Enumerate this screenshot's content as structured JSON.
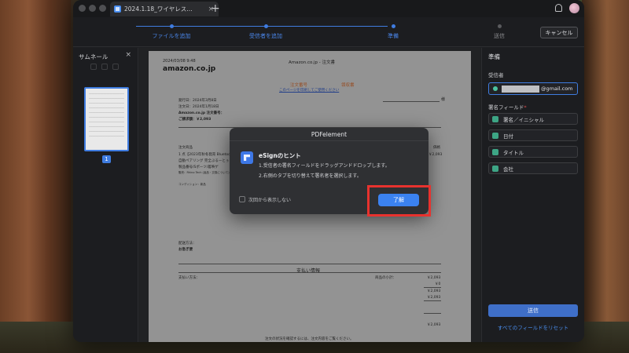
{
  "titlebar": {
    "tab_title": "2024.1.18_ワイヤレス…",
    "tab_close": "×",
    "new_tab": "+"
  },
  "steps": [
    {
      "label": "ファイルを追加",
      "state": "done"
    },
    {
      "label": "受信者を追加",
      "state": "done"
    },
    {
      "label": "準備",
      "state": "current"
    },
    {
      "label": "送信",
      "state": "pending"
    }
  ],
  "toolbar": {
    "cancel_label": "キャンセル"
  },
  "sidebar": {
    "title": "サムネール",
    "close": "×",
    "page_number": "1"
  },
  "document": {
    "header_date": "2024/03/08 9:48",
    "header_title": "Amazon.co.jp - 注文書",
    "logo": "amazon.co.jp",
    "order_label": "注文番号",
    "receipt_label": "領収書",
    "print_link": "このページを印刷してご使用ください",
    "line1": "発行日：2024年3月8日",
    "line2": "注文日：2024年1月18日",
    "line3": "Amazon.co.jp 注文番号：",
    "line4": "ご請求額：￥2,093",
    "honorific": "様",
    "item_head": "注文商品",
    "item1": "1 点【2023年秋冬発売 Bluetoo",
    "item2": "自動ペアリング 完全ぶるーとぅ",
    "item3": "製品番号/Sポーツ/着映ゲ",
    "item4": "販売：Rhino Tech (返品・交換について)",
    "condition": "コンディション：新品",
    "price_head": "価格",
    "price_val": "￥2,093",
    "ship_label": "配送方法：",
    "ship_val": "お急ぎ便",
    "payment_title": "支払い情報",
    "payment_method": "支払い方法：",
    "subtotal_label": "商品の小計：",
    "sub1": "￥2,093",
    "sub2": "￥0",
    "sub3": "￥2,093",
    "sub4": "￥2,093",
    "sub5": "￥2,093",
    "footer": "注文の状況を確認するには、注文内容をご覧ください。"
  },
  "right_panel": {
    "title": "準備",
    "recipient_label": "受信者",
    "recipient_email_suffix": "@gmail.com",
    "fields_label": "署名フィールド",
    "required_mark": "*",
    "fields": [
      {
        "label": "署名／イニシャル",
        "color": "#3da585"
      },
      {
        "label": "日付",
        "color": "#3da585"
      },
      {
        "label": "タイトル",
        "color": "#3da585"
      },
      {
        "label": "会社",
        "color": "#3da585"
      }
    ],
    "send_label": "送信",
    "reset_label": "すべてのフィールドをリセット"
  },
  "dialog": {
    "title": "PDFelement",
    "heading": "eSignのヒント",
    "line1": "1.受信者の署名フィールドをドラッグアンドドロップします。",
    "line2": "2.右側のタブを切り替えて署名者を選択します。",
    "checkbox_label": "次回から表示しない",
    "ok_label": "了解"
  },
  "colors": {
    "accent": "#3b82f0",
    "highlight": "#e8322e",
    "field_swatch": "#3da585"
  }
}
